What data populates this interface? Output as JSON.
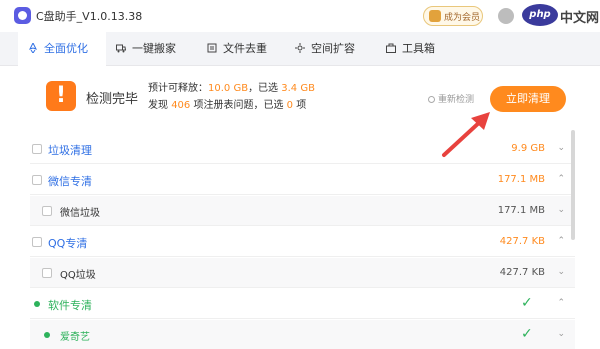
{
  "app": {
    "title": "C盘助手_V1.0.13.38"
  },
  "header": {
    "vip_label": "成为会员",
    "watermark": "php中文网"
  },
  "tabs": [
    {
      "label": "全面优化",
      "icon": "rocket-icon",
      "active": true
    },
    {
      "label": "一键搬家",
      "icon": "truck-icon",
      "active": false
    },
    {
      "label": "文件去重",
      "icon": "files-icon",
      "active": false
    },
    {
      "label": "空间扩容",
      "icon": "expand-icon",
      "active": false
    },
    {
      "label": "工具箱",
      "icon": "toolbox-icon",
      "active": false
    }
  ],
  "summary": {
    "status": "检测完毕",
    "line1_prefix": "预计可释放：",
    "releasable": "10.0 GB",
    "line1_mid": "，已选",
    "selected": "3.4 GB",
    "line2_prefix": "发现",
    "issues": "406",
    "line2_mid": "项注册表问题，已选",
    "issues_selected": "0",
    "line2_suffix": "项",
    "rescan": "重新检测",
    "clean_button": "立即清理"
  },
  "list": [
    {
      "label": "垃圾清理",
      "size": "9.9 GB",
      "level": "top",
      "chev": "down"
    },
    {
      "label": "微信专清",
      "size": "177.1 MB",
      "level": "top",
      "chev": "up"
    },
    {
      "label": "微信垃圾",
      "size": "177.1 MB",
      "level": "sub",
      "chev": "down"
    },
    {
      "label": "QQ专清",
      "size": "427.7 KB",
      "level": "top",
      "chev": "up"
    },
    {
      "label": "QQ垃圾",
      "size": "427.7 KB",
      "level": "sub",
      "chev": "down"
    },
    {
      "label": "软件专清",
      "size": "",
      "level": "top-done",
      "chev": "up"
    },
    {
      "label": "爱奇艺",
      "size": "",
      "level": "sub-done",
      "chev": "down"
    }
  ],
  "colors": {
    "accent": "#2f6fe4",
    "orange": "#ff8a1e",
    "green": "#2db25b",
    "arrow": "#e8423e"
  }
}
